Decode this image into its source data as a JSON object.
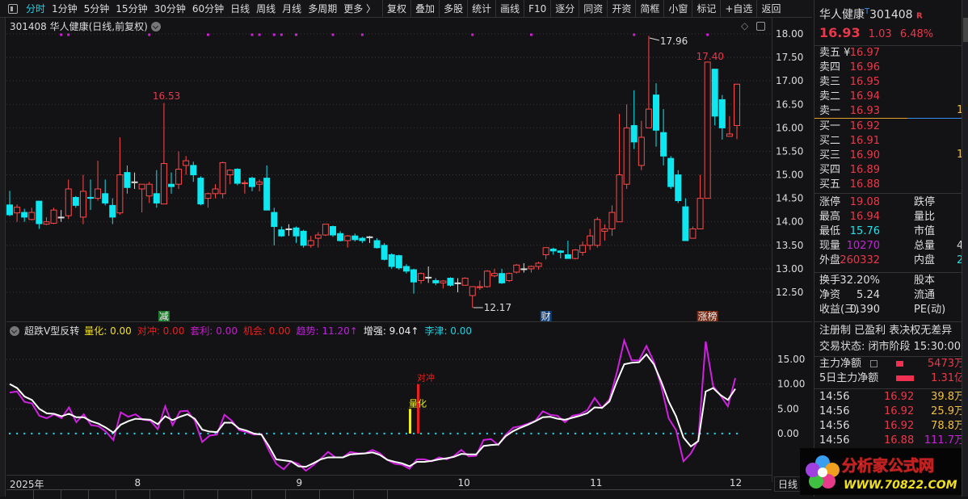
{
  "toolbar": {
    "periods": [
      "分时",
      "1分钟",
      "5分钟",
      "15分钟",
      "30分钟",
      "60分钟",
      "日线",
      "周线",
      "月线",
      "多周期",
      "更多 〉"
    ],
    "active_index": 0,
    "buttons": [
      "复权",
      "叠加",
      "多股",
      "统计",
      "画线",
      "F10",
      "逐分",
      "同资",
      "开资",
      "简框",
      "小窗",
      "标记",
      "+自选",
      "返回"
    ]
  },
  "chart": {
    "title": "301408 华人健康(日线,前复权)",
    "price_ticks": [
      "18.00",
      "17.50",
      "17.00",
      "16.50",
      "16.00",
      "15.50",
      "15.00",
      "14.50",
      "14.00",
      "13.50",
      "13.00",
      "12.50"
    ],
    "annotations": {
      "high1": "16.53",
      "max": "17.96",
      "min": "12.17",
      "high2": "17.40"
    },
    "event_labels": [
      {
        "text": "减",
        "index": 21,
        "color": "#1a7a2a"
      },
      {
        "text": "财",
        "index": 73,
        "color": "#12427a"
      },
      {
        "text": "涨榜",
        "index": 95,
        "color": "#7a2a12"
      }
    ],
    "signal_dot_indices": [
      7,
      8,
      19,
      27,
      33,
      34,
      36,
      37,
      39,
      44,
      48,
      63,
      71,
      85,
      95
    ],
    "colors": {
      "up": "#ff4a4a",
      "down": "#0ee6f0",
      "signal": "#d020d8"
    },
    "candles_ohlc": [
      [
        14.36,
        14.15,
        14.66,
        14.12
      ],
      [
        14.19,
        14.31,
        14.37,
        14.0
      ],
      [
        14.2,
        14.1,
        14.28,
        14.0
      ],
      [
        14.05,
        14.2,
        14.3,
        14.03
      ],
      [
        14.44,
        13.96,
        14.44,
        13.85
      ],
      [
        13.95,
        14.0,
        14.1,
        13.93
      ],
      [
        13.97,
        14.25,
        14.3,
        13.95
      ],
      [
        14.1,
        14.1,
        14.25,
        14.0
      ],
      [
        14.13,
        14.7,
        14.9,
        14.06
      ],
      [
        14.52,
        14.35,
        14.55,
        14.3
      ],
      [
        14.1,
        14.65,
        15.0,
        13.95
      ],
      [
        14.52,
        14.5,
        14.9,
        14.25
      ],
      [
        14.5,
        14.7,
        15.3,
        14.45
      ],
      [
        14.6,
        14.4,
        14.9,
        14.35
      ],
      [
        14.35,
        14.1,
        14.5,
        13.95
      ],
      [
        14.19,
        15.0,
        15.8,
        14.15
      ],
      [
        15.05,
        14.73,
        15.2,
        14.6
      ],
      [
        14.85,
        14.85,
        15.05,
        14.7
      ],
      [
        14.7,
        14.8,
        14.8,
        14.2
      ],
      [
        14.55,
        14.8,
        14.85,
        14.4
      ],
      [
        14.6,
        14.4,
        15.1,
        14.3
      ],
      [
        14.38,
        15.24,
        16.53,
        14.38
      ],
      [
        14.8,
        14.75,
        15.05,
        14.6
      ],
      [
        14.8,
        15.12,
        15.5,
        14.7
      ],
      [
        15.2,
        15.3,
        15.4,
        15.0
      ],
      [
        15.2,
        15.0,
        15.28,
        14.85
      ],
      [
        14.93,
        14.38,
        14.97,
        14.35
      ],
      [
        14.5,
        14.6,
        14.62,
        14.3
      ],
      [
        14.6,
        14.7,
        14.8,
        14.5
      ],
      [
        14.6,
        15.26,
        15.28,
        14.5
      ],
      [
        15.0,
        15.1,
        15.12,
        14.8
      ],
      [
        15.12,
        14.82,
        15.14,
        14.78
      ],
      [
        14.82,
        14.83,
        14.88,
        14.6
      ],
      [
        14.93,
        14.75,
        14.96,
        14.65
      ],
      [
        14.8,
        14.85,
        14.9,
        14.65
      ],
      [
        14.93,
        14.25,
        15.2,
        14.25
      ],
      [
        14.2,
        13.9,
        14.3,
        13.5
      ],
      [
        13.83,
        13.7,
        13.9,
        13.68
      ],
      [
        13.85,
        13.85,
        13.95,
        13.7
      ],
      [
        13.87,
        13.7,
        13.9,
        13.55
      ],
      [
        13.8,
        13.5,
        13.83,
        13.45
      ],
      [
        13.5,
        13.6,
        13.7,
        13.45
      ],
      [
        13.65,
        13.72,
        13.78,
        13.45
      ],
      [
        13.72,
        13.95,
        13.95,
        13.7
      ],
      [
        13.9,
        13.72,
        13.92,
        13.68
      ],
      [
        13.75,
        13.6,
        13.8,
        13.58
      ],
      [
        13.6,
        13.7,
        13.72,
        13.45
      ],
      [
        13.7,
        13.62,
        13.75,
        13.58
      ],
      [
        13.65,
        13.6,
        13.68,
        13.55
      ],
      [
        13.68,
        13.68,
        13.7,
        13.55
      ],
      [
        13.6,
        13.45,
        13.65,
        13.43
      ],
      [
        13.5,
        13.2,
        13.55,
        13.18
      ],
      [
        13.3,
        13.05,
        13.33,
        13.0
      ],
      [
        13.28,
        13.02,
        13.3,
        12.98
      ],
      [
        13.05,
        12.95,
        13.1,
        12.9
      ],
      [
        12.98,
        12.72,
        13.0,
        12.47
      ],
      [
        12.75,
        12.9,
        12.92,
        12.68
      ],
      [
        12.82,
        12.82,
        13.05,
        12.7
      ],
      [
        12.75,
        12.7,
        12.8,
        12.65
      ],
      [
        12.7,
        12.74,
        12.76,
        12.58
      ],
      [
        12.8,
        12.65,
        12.82,
        12.62
      ],
      [
        12.7,
        12.7,
        12.8,
        12.5
      ],
      [
        12.65,
        12.8,
        12.82,
        12.65
      ],
      [
        12.43,
        12.62,
        12.62,
        12.17
      ],
      [
        12.6,
        12.62,
        12.75,
        12.55
      ],
      [
        12.62,
        12.95,
        12.97,
        12.6
      ],
      [
        12.85,
        12.9,
        13.0,
        12.82
      ],
      [
        12.9,
        12.7,
        13.0,
        12.68
      ],
      [
        12.75,
        12.9,
        12.92,
        12.72
      ],
      [
        12.93,
        13.08,
        13.1,
        12.9
      ],
      [
        13.0,
        13.0,
        13.12,
        12.92
      ],
      [
        13.0,
        13.05,
        13.07,
        12.92
      ],
      [
        13.05,
        13.12,
        13.15,
        12.98
      ],
      [
        13.3,
        13.45,
        13.45,
        13.2
      ],
      [
        13.42,
        13.38,
        13.45,
        13.3
      ],
      [
        13.38,
        13.35,
        13.4,
        13.22
      ],
      [
        13.3,
        13.22,
        13.6,
        13.22
      ],
      [
        13.22,
        13.4,
        13.42,
        13.2
      ],
      [
        13.35,
        13.5,
        13.58,
        13.28
      ],
      [
        13.5,
        13.7,
        13.85,
        13.4
      ],
      [
        13.5,
        14.05,
        14.1,
        13.45
      ],
      [
        13.8,
        13.85,
        13.95,
        13.6
      ],
      [
        13.85,
        14.2,
        14.35,
        13.7
      ],
      [
        14.0,
        15.0,
        16.3,
        14.0
      ],
      [
        14.8,
        16.0,
        16.5,
        14.7
      ],
      [
        16.05,
        15.7,
        16.8,
        15.55
      ],
      [
        15.2,
        15.8,
        16.15,
        15.1
      ],
      [
        16.0,
        16.4,
        17.96,
        16.0
      ],
      [
        16.7,
        15.95,
        16.95,
        15.6
      ],
      [
        15.9,
        15.4,
        16.4,
        15.2
      ],
      [
        15.35,
        14.75,
        15.4,
        14.7
      ],
      [
        15.0,
        14.45,
        15.1,
        14.4
      ],
      [
        14.32,
        13.6,
        14.5,
        13.6
      ],
      [
        13.65,
        13.85,
        13.9,
        13.65
      ],
      [
        13.85,
        14.5,
        15.0,
        13.85
      ],
      [
        14.5,
        17.4,
        17.4,
        14.5
      ],
      [
        17.25,
        16.25,
        17.25,
        16.05
      ],
      [
        16.6,
        16.0,
        16.7,
        15.75
      ],
      [
        15.82,
        15.87,
        16.25,
        15.82
      ],
      [
        16.05,
        16.93,
        16.94,
        15.76
      ]
    ]
  },
  "indicator": {
    "name": "超跌V型反转",
    "fields": [
      {
        "label": "量化: 0.00",
        "color": "#f0e020"
      },
      {
        "label": "对冲: 0.00",
        "color": "#e82020"
      },
      {
        "label": "套利: 0.00",
        "color": "#c020c8"
      },
      {
        "label": "机会: 0.00",
        "color": "#e82020"
      },
      {
        "label": "趋势: 11.20↑",
        "color": "#c020e0"
      },
      {
        "label": "增强: 9.04↑",
        "color": "#eeeeee"
      },
      {
        "label": "李津: 0.00",
        "color": "#20d0e0"
      }
    ],
    "ticks": [
      "15.00",
      "10.00",
      "5.00",
      "0.00"
    ],
    "bar_labels": {
      "lianghua": "量化",
      "duichong": "对冲"
    },
    "bars": {
      "lianghua": 5,
      "duichong": 10
    },
    "trend": [
      8.3,
      8.5,
      6.4,
      6.1,
      3.6,
      3.1,
      3.9,
      3.1,
      5.3,
      2.3,
      3.9,
      1.7,
      1.5,
      0.4,
      -1.3,
      4.3,
      3.4,
      3.9,
      2.8,
      2.6,
      0.9,
      5.5,
      1.7,
      4.5,
      4.6,
      2.6,
      -1.7,
      -0.4,
      -0.2,
      3.8,
      2.6,
      0.7,
      0.3,
      -0.2,
      -0.1,
      -3.4,
      -6.1,
      -7.2,
      -5.6,
      -6.1,
      -7.5,
      -6.4,
      -5.1,
      -3.7,
      -4.8,
      -4.8,
      -3.7,
      -4.0,
      -4.0,
      -3.3,
      -4.0,
      -5.3,
      -6.1,
      -6.3,
      -7.1,
      -5.2,
      -5.2,
      -5.6,
      -4.8,
      -5.2,
      -4.5,
      -3.3,
      -4.6,
      -4.5,
      -1.3,
      -1.1,
      -2.3,
      -0.2,
      1.2,
      1.5,
      2.0,
      2.6,
      4.5,
      3.8,
      3.6,
      2.3,
      3.6,
      3.9,
      4.7,
      7.2,
      5.2,
      6.9,
      12.3,
      18.8,
      14.8,
      14.8,
      17.7,
      14.5,
      9.6,
      3.1,
      0.7,
      -5.6,
      -4.0,
      -1.3,
      18.6,
      9.6,
      7.7,
      5.5,
      11.2
    ],
    "enhance": [
      10.0,
      9.2,
      7.5,
      6.8,
      5.0,
      4.1,
      4.0,
      3.5,
      4.0,
      3.3,
      3.3,
      2.5,
      2.0,
      1.2,
      0.2,
      1.8,
      2.5,
      3.0,
      2.9,
      2.8,
      1.9,
      3.5,
      2.7,
      3.4,
      3.9,
      3.0,
      0.8,
      0.4,
      0.3,
      2.2,
      2.2,
      1.0,
      0.6,
      0.0,
      -0.2,
      -2.5,
      -5.2,
      -5.4,
      -5.6,
      -6.6,
      -6.7,
      -6.0,
      -5.2,
      -4.8,
      -4.8,
      -4.8,
      -4.2,
      -4.1,
      -4.0,
      -3.8,
      -4.3,
      -5.3,
      -5.7,
      -6.0,
      -6.6,
      -5.7,
      -5.7,
      -5.5,
      -5.2,
      -5.0,
      -4.7,
      -4.1,
      -4.2,
      -4.2,
      -2.5,
      -2.3,
      -2.2,
      -0.5,
      0.5,
      1.2,
      1.8,
      2.5,
      3.3,
      3.4,
      3.0,
      2.8,
      3.2,
      3.6,
      4.1,
      5.3,
      5.2,
      6.5,
      10.5,
      14.0,
      14.3,
      14.4,
      16.0,
      14.0,
      10.5,
      6.5,
      3.5,
      -0.8,
      -2.6,
      -1.5,
      8.5,
      9.2,
      7.8,
      6.8,
      9.04
    ]
  },
  "time_axis": [
    {
      "text": "2025年",
      "index": 0
    },
    {
      "text": "8",
      "index": 17
    },
    {
      "text": "9",
      "index": 39
    },
    {
      "text": "10",
      "index": 61
    },
    {
      "text": "11",
      "index": 79
    },
    {
      "text": "12",
      "index": 98
    }
  ],
  "period_label": "日线",
  "quote": {
    "name": "华人健康",
    "code": "301408",
    "tag": "R",
    "t_mark": "T",
    "price": "16.93",
    "change": "1.03",
    "pct": "6.48%",
    "asks": [
      {
        "l": "卖五 ¥",
        "v": "16.97"
      },
      {
        "l": "卖四",
        "v": "16.96"
      },
      {
        "l": "卖三",
        "v": "16.95"
      },
      {
        "l": "卖二",
        "v": "16.94"
      },
      {
        "l": "卖一",
        "v": "16.93"
      }
    ],
    "bids": [
      {
        "l": "买一",
        "v": "16.92"
      },
      {
        "l": "买二",
        "v": "16.91"
      },
      {
        "l": "买三",
        "v": "16.90"
      },
      {
        "l": "买四",
        "v": "16.89"
      },
      {
        "l": "买五",
        "v": "16.88"
      }
    ],
    "ask_vol_partial": "1",
    "bid_vol_partial": "1",
    "stats": [
      {
        "l": "涨停",
        "v": "19.08",
        "c": "red",
        "l2": "跌停",
        "v2": ""
      },
      {
        "l": "最高",
        "v": "16.94",
        "c": "red",
        "l2": "量比",
        "v2": ""
      },
      {
        "l": "最低",
        "v": "15.76",
        "c": "cyan",
        "l2": "市值",
        "v2": ""
      },
      {
        "l": "现量",
        "v": "10270",
        "c": "purple",
        "l2": "总量",
        "v2": "4"
      },
      {
        "l": "外盘",
        "v": "260332",
        "c": "red",
        "l2": "内盘",
        "v2": "2"
      }
    ],
    "stats2": [
      {
        "l": "换手",
        "v": "32.20%",
        "l2": "股本"
      },
      {
        "l": "净资",
        "v": "5.24",
        "l2": "流通"
      },
      {
        "l": "收益(三)",
        "v": "0.390",
        "l2": "PE(动)"
      }
    ],
    "tags": "注册制 已盈利 表决权无差异",
    "status": "交易状态: 闭市阶段 15:30:00",
    "main_net": {
      "l": "主力净额",
      "v": "5473万"
    },
    "main_net5": {
      "l": "5日主力净额",
      "v": "1.31亿"
    },
    "ticks": [
      {
        "t": "14:56",
        "p": "16.92",
        "v": "39.8万",
        "c": "yellow"
      },
      {
        "t": "14:56",
        "p": "16.92",
        "v": "25.9万",
        "c": "yellow"
      },
      {
        "t": "14:56",
        "p": "16.92",
        "v": "78.8万",
        "c": "yellow"
      },
      {
        "t": "14:56",
        "p": "16.88",
        "v": "111.7万",
        "c": "purple"
      }
    ]
  },
  "watermark": {
    "text": "分析家公式网",
    "url": "WWW.70822.COM"
  }
}
